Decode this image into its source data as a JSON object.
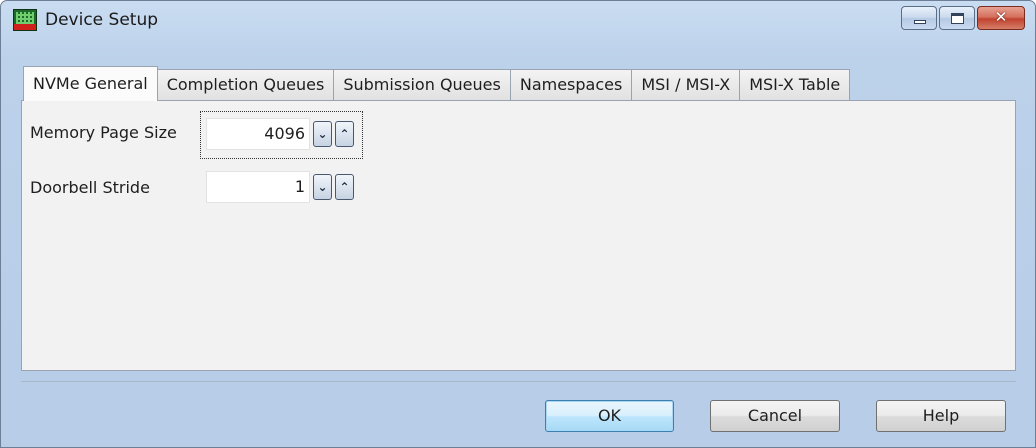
{
  "window": {
    "title": "Device Setup"
  },
  "tabs": [
    {
      "label": "NVMe General",
      "active": true
    },
    {
      "label": "Completion Queues",
      "active": false
    },
    {
      "label": "Submission Queues",
      "active": false
    },
    {
      "label": "Namespaces",
      "active": false
    },
    {
      "label": "MSI / MSI-X",
      "active": false
    },
    {
      "label": "MSI-X Table",
      "active": false
    }
  ],
  "fields": {
    "memory_page_size": {
      "label": "Memory Page Size",
      "value": "4096"
    },
    "doorbell_stride": {
      "label": "Doorbell Stride",
      "value": "1"
    }
  },
  "spin_glyphs": {
    "down": "⌄",
    "up": "⌃"
  },
  "buttons": {
    "ok": "OK",
    "cancel": "Cancel",
    "help": "Help"
  },
  "caption": {
    "close_glyph": "✕"
  }
}
